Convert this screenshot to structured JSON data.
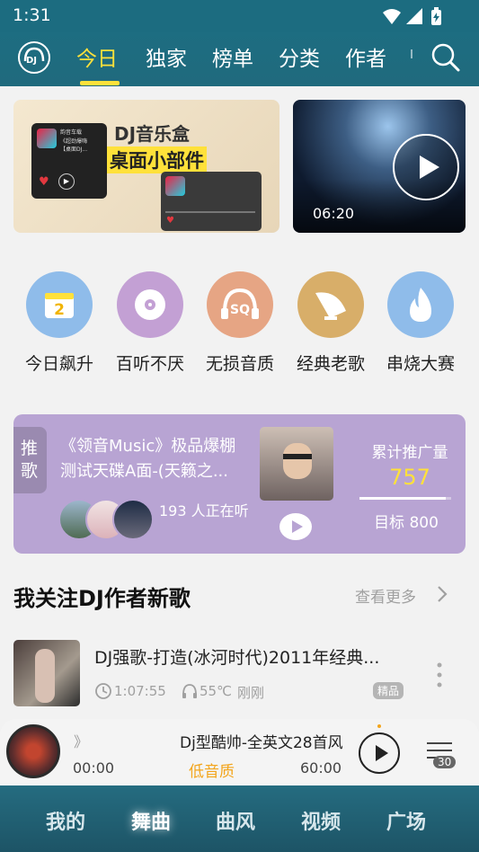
{
  "status": {
    "time": "1:31"
  },
  "header": {
    "logo_text": "DJ",
    "tabs": [
      {
        "label": "今日",
        "active": true
      },
      {
        "label": "独家"
      },
      {
        "label": "榜单"
      },
      {
        "label": "分类"
      },
      {
        "label": "作者"
      }
    ]
  },
  "banners": [
    {
      "title": "DJ音乐盒",
      "subtitle": "桌面小部件",
      "widget_line1": "韵音车载",
      "widget_line2": "《超劲爆嗨",
      "widget_line3": "【桌面DJ..."
    },
    {
      "duration": "06:20"
    }
  ],
  "categories": [
    {
      "label": "今日飙升",
      "icon": "calendar-icon",
      "badge": "2",
      "color": "#8fbcea"
    },
    {
      "label": "百听不厌",
      "icon": "disc-icon",
      "color": "#c3a0d4"
    },
    {
      "label": "无损音质",
      "icon": "headphones-sq-icon",
      "badge": "SQ",
      "color": "#e6a584"
    },
    {
      "label": "经典老歌",
      "icon": "gramophone-icon",
      "color": "#d8ae69"
    },
    {
      "label": "串烧大赛",
      "icon": "flame-icon",
      "color": "#8fbcea"
    }
  ],
  "promo": {
    "tag": "推歌",
    "title": "《领音Music》极品爆棚测试天碟A面-(天籁之...",
    "listeners": "193 人正在听",
    "stat_label": "累计推广量",
    "stat_value": "757",
    "target": "目标 800",
    "progress": 0.946
  },
  "section": {
    "title": "我关注DJ作者新歌",
    "more": "查看更多"
  },
  "songs": [
    {
      "title": "DJ强歌-打造(冰河时代)2011年经典...",
      "duration": "1:07:55",
      "temp": "55℃",
      "time": "刚刚",
      "badge": "精品"
    }
  ],
  "player": {
    "title": "Dj型酷帅-全英文28首风",
    "elapsed": "00:00",
    "quality": "低音质",
    "total": "60:00",
    "queue_count": "30"
  },
  "bottom_nav": [
    {
      "label": "我的"
    },
    {
      "label": "舞曲",
      "active": true
    },
    {
      "label": "曲风"
    },
    {
      "label": "视频"
    },
    {
      "label": "广场"
    }
  ],
  "colors": {
    "accent": "#ffe13a",
    "header": "#1d6d81",
    "promo": "#b8a4d3",
    "quality": "#f3a51c",
    "stat_value": "#ffe13a"
  }
}
